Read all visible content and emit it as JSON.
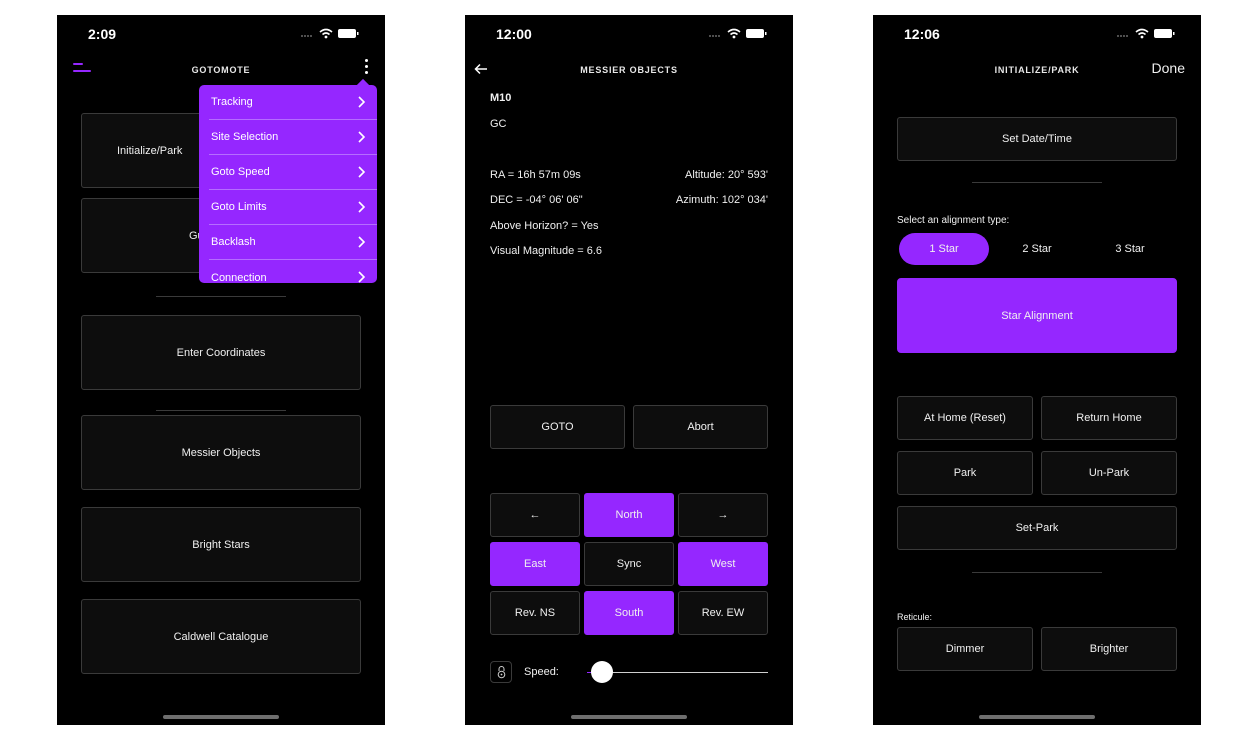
{
  "colors": {
    "accent": "#9527ff",
    "background": "#000000",
    "tile_border": "#3a3a3a"
  },
  "screen1": {
    "time": "2:09",
    "title": "GOTOMOTE",
    "icons": {
      "menu": "hamburger-icon",
      "more": "kebab-icon"
    },
    "menu_items": [
      {
        "label": "Tracking"
      },
      {
        "label": "Site Selection"
      },
      {
        "label": "Goto Speed"
      },
      {
        "label": "Goto Limits"
      },
      {
        "label": "Backlash"
      },
      {
        "label": "Connection"
      }
    ],
    "tiles": {
      "initialize": "Initialize/Park",
      "guide_partial": "Gu",
      "enter_coordinates": "Enter Coordinates",
      "messier": "Messier Objects",
      "bright_stars": "Bright Stars",
      "caldwell": "Caldwell Catalogue"
    }
  },
  "screen2": {
    "time": "12:00",
    "title": "MESSIER OBJECTS",
    "object_name": "M10",
    "object_type": "GC",
    "ra": "RA = 16h 57m 09s",
    "dec": "DEC = -04° 06' 06\"",
    "above_horizon": "Above Horizon? = Yes",
    "visual_magnitude": "Visual Magnitude = 6.6",
    "altitude": "Altitude: 20° 593'",
    "azimuth": "Azimuth: 102° 034'",
    "goto_label": "GOTO",
    "abort_label": "Abort",
    "pad": {
      "left_arrow": "←",
      "north": "North",
      "right_arrow": "→",
      "east": "East",
      "sync": "Sync",
      "west": "West",
      "rev_ns": "Rev. NS",
      "south": "South",
      "rev_ew": "Rev. EW"
    },
    "speed_label": "Speed:",
    "speed_level": 0.06
  },
  "screen3": {
    "time": "12:06",
    "title": "INITIALIZE/PARK",
    "done_label": "Done",
    "set_datetime": "Set Date/Time",
    "alignment_prompt": "Select an alignment type:",
    "alignment_options": [
      "1 Star",
      "2 Star",
      "3 Star"
    ],
    "alignment_selected": "1 Star",
    "star_alignment": "Star Alignment",
    "at_home": "At Home (Reset)",
    "return_home": "Return Home",
    "park": "Park",
    "unpark": "Un-Park",
    "set_park": "Set-Park",
    "reticule_label": "Reticule:",
    "dimmer": "Dimmer",
    "brighter": "Brighter"
  }
}
